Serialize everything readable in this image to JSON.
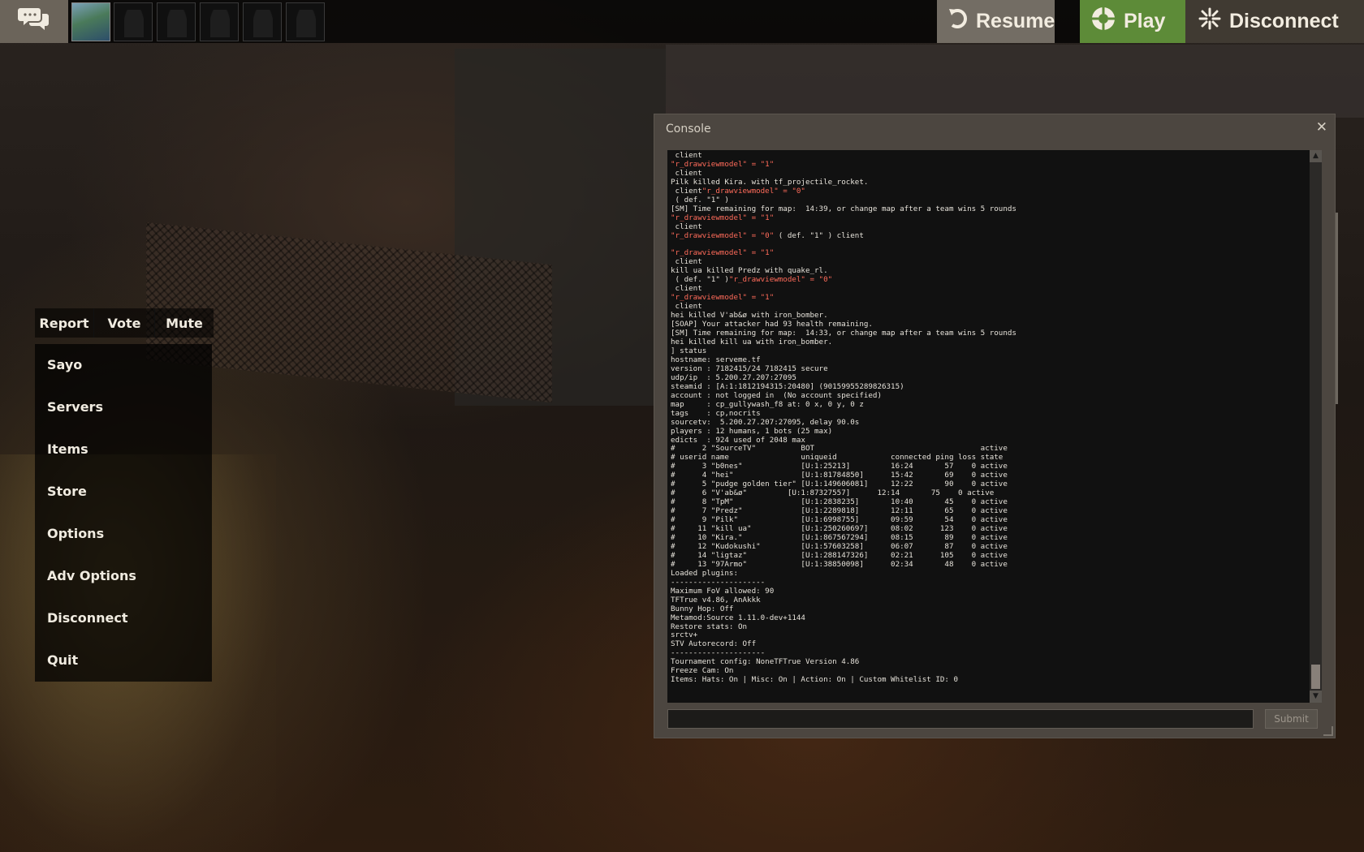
{
  "topbar": {
    "chat_icon": "chat-bubbles-icon",
    "avatars": [
      {
        "label": "player-avatar",
        "self": true
      },
      {
        "label": "player-slot"
      },
      {
        "label": "player-slot"
      },
      {
        "label": "player-slot"
      },
      {
        "label": "player-slot"
      },
      {
        "label": "player-slot"
      }
    ],
    "resume": {
      "label": "Resume",
      "icon": "resume-arrow-icon"
    },
    "play": {
      "label": "Play",
      "icon": "play-logo-icon"
    },
    "disconnect": {
      "label": "Disconnect",
      "icon": "disconnect-spark-icon"
    }
  },
  "menu": {
    "tabs": [
      "Report",
      "Vote",
      "Mute"
    ],
    "items": [
      "Sayo",
      "Servers",
      "Items",
      "Store",
      "Options",
      "Adv Options",
      "Disconnect",
      "Quit"
    ]
  },
  "console": {
    "title": "Console",
    "close_glyph": "✕",
    "submit_label": "Submit",
    "input_value": "",
    "lines": [
      " client",
      "\"r_drawviewmodel\" = \"1\"",
      " client",
      "Pilk killed Kira. with tf_projectile_rocket.",
      " client\"r_drawviewmodel\" = \"0\"",
      " ( def. \"1\" )",
      "[SM] Time remaining for map:  14:39, or change map after a team wins 5 rounds",
      "\"r_drawviewmodel\" = \"1\"",
      " client",
      "\"r_drawviewmodel\" = \"0\" ( def. \"1\" ) client",
      "",
      "\"r_drawviewmodel\" = \"1\"",
      " client",
      "kill ua killed Predz with quake_rl.",
      " ( def. \"1\" )\"r_drawviewmodel\" = \"0\"",
      " client",
      "\"r_drawviewmodel\" = \"1\"",
      " client",
      "hei killed V'ab&ø with iron_bomber.",
      "[SOAP] Your attacker had 93 health remaining.",
      "[SM] Time remaining for map:  14:33, or change map after a team wins 5 rounds",
      "hei killed kill ua with iron_bomber.",
      "] status",
      "hostname: serveme.tf",
      "version : 7182415/24 7182415 secure",
      "udp/ip  : 5.200.27.207:27095",
      "steamid : [A:1:1812194315:20480] (90159955289826315)",
      "account : not logged in  (No account specified)",
      "map     : cp_gullywash_f8 at: 0 x, 0 y, 0 z",
      "tags    : cp,nocrits",
      "sourcetv:  5.200.27.207:27095, delay 90.0s",
      "players : 12 humans, 1 bots (25 max)",
      "edicts  : 924 used of 2048 max",
      "#      2 \"SourceTV\"          BOT                                     active",
      "# userid name                uniqueid            connected ping loss state",
      "#      3 \"b0nes\"             [U:1:25213]         16:24       57    0 active",
      "#      4 \"hei\"               [U:1:81784850]      15:42       69    0 active",
      "#      5 \"pudge golden tier\" [U:1:149606081]     12:22       90    0 active",
      "#      6 \"V'ab&ø\"         [U:1:87327557]      12:14       75    0 active",
      "#      8 \"TpM\"               [U:1:2838235]       10:40       45    0 active",
      "#      7 \"Predz\"             [U:1:2289818]       12:11       65    0 active",
      "#      9 \"Pilk\"              [U:1:6998755]       09:59       54    0 active",
      "#     11 \"kill ua\"           [U:1:250260697]     08:02      123    0 active",
      "#     10 \"Kira.\"             [U:1:867567294]     08:15       89    0 active",
      "#     12 \"Kudokushi\"         [U:1:57603258]      06:07       87    0 active",
      "#     14 \"ligtaz\"            [U:1:288147326]     02:21      105    0 active",
      "#     13 \"97Armo\"            [U:1:38850098]      02:34       48    0 active",
      "Loaded plugins:",
      "---------------------",
      "Maximum FoV allowed: 90",
      "TFTrue v4.86, AnAkkk",
      "Bunny Hop: Off",
      "Metamod:Source 1.11.0-dev+1144",
      "Restore stats: On",
      "srctv+",
      "STV Autorecord: Off",
      "---------------------",
      "Tournament config: NoneTFTrue Version 4.86",
      "Freeze Cam: On",
      "Items: Hats: On | Misc: On | Action: On | Custom Whitelist ID: 0"
    ]
  }
}
